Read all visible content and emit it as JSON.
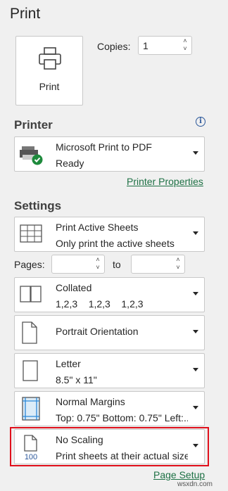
{
  "header": {
    "title": "Print"
  },
  "print_button": {
    "label": "Print",
    "icon": "printer-icon"
  },
  "copies": {
    "label": "Copies:",
    "value": "1"
  },
  "printer": {
    "heading": "Printer",
    "info_icon": "info-icon",
    "name": "Microsoft Print to PDF",
    "status": "Ready",
    "properties_link": "Printer Properties"
  },
  "settings": {
    "heading": "Settings",
    "sheets": {
      "line1": "Print Active Sheets",
      "line2": "Only print the active sheets"
    },
    "pages": {
      "label": "Pages:",
      "from": "",
      "to_label": "to",
      "to": ""
    },
    "collation": {
      "line1": "Collated",
      "line2": "1,2,3    1,2,3    1,2,3"
    },
    "orientation": {
      "line1": "Portrait Orientation"
    },
    "paper": {
      "line1": "Letter",
      "line2": "8.5\" x 11\""
    },
    "margins": {
      "line1": "Normal Margins",
      "line2": "Top: 0.75\" Bottom: 0.75\" Left:..."
    },
    "scaling": {
      "line1": "No Scaling",
      "line2": "Print sheets at their actual size",
      "icon_text": "100"
    },
    "page_setup_link": "Page Setup"
  },
  "watermark": "wsxdn.com",
  "colors": {
    "link": "#1e7145",
    "highlight": "#e0101c",
    "accent": "#2b579a"
  }
}
